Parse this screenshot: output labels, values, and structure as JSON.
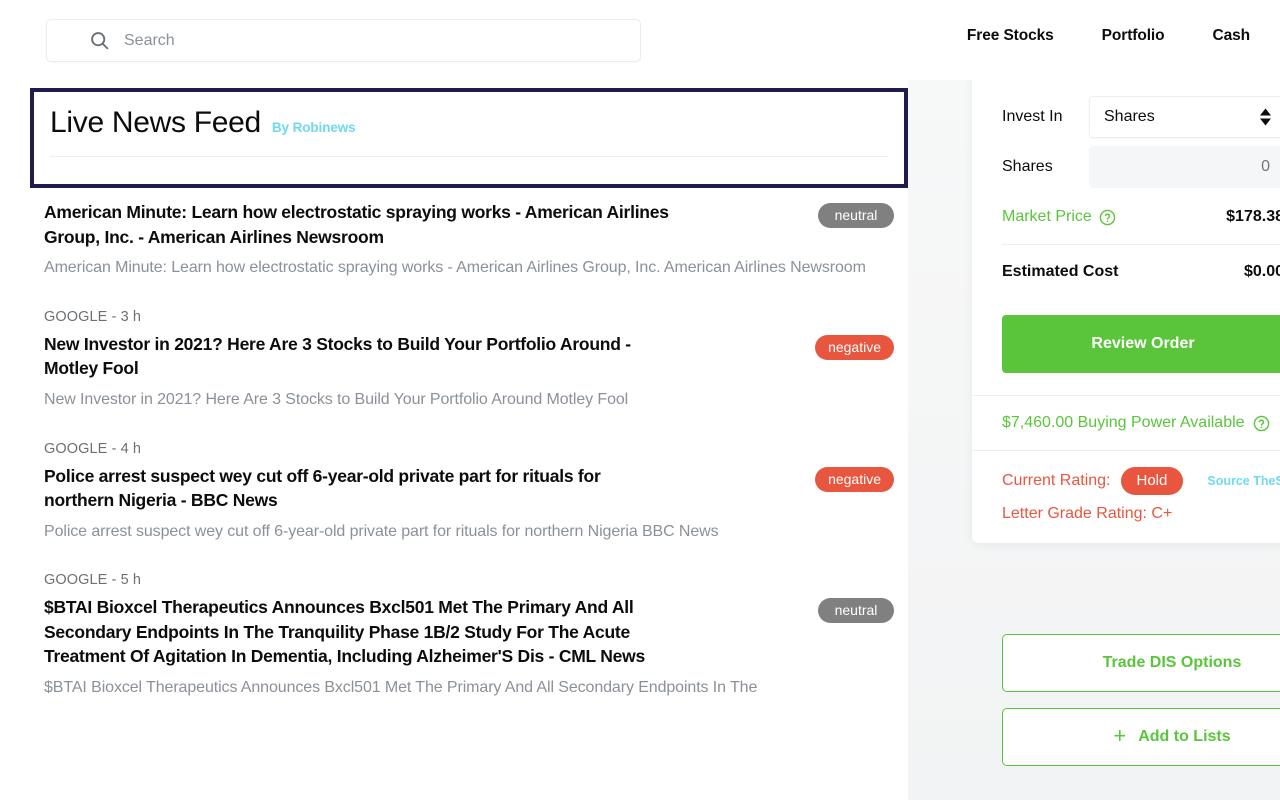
{
  "search": {
    "placeholder": "Search",
    "value": "",
    "icon": "search-icon"
  },
  "nav": {
    "items": [
      {
        "label": "Free Stocks"
      },
      {
        "label": "Portfolio"
      },
      {
        "label": "Cash"
      }
    ]
  },
  "feed": {
    "title": "Live News Feed",
    "byline": "By Robinews",
    "byline_color": "#6fd9f2",
    "highlight_border_color": "#1f1b4d",
    "items": [
      {
        "source_time": "",
        "title": "American Minute: Learn how electrostatic spraying works - American Airlines Group, Inc. - American Airlines Newsroom",
        "description": "American Minute: Learn how electrostatic spraying works - American Airlines Group, Inc.  American Airlines Newsroom",
        "sentiment": "neutral",
        "sentiment_color": "#808080"
      },
      {
        "source_time": "GOOGLE - 3 h",
        "title": "New Investor in 2021? Here Are 3 Stocks to Build Your Portfolio Around - Motley Fool",
        "description": "New Investor in 2021? Here Are 3 Stocks to Build Your Portfolio Around  Motley Fool",
        "sentiment": "negative",
        "sentiment_color": "#e8563f"
      },
      {
        "source_time": "GOOGLE - 4 h",
        "title": "Police arrest suspect wey cut off 6-year-old private part for rituals for northern Nigeria - BBC News",
        "description": "Police arrest suspect wey cut off 6-year-old private part for rituals for northern Nigeria  BBC News",
        "sentiment": "negative",
        "sentiment_color": "#e8563f"
      },
      {
        "source_time": "GOOGLE - 5 h",
        "title": "$BTAI Bioxcel Therapeutics Announces Bxcl501 Met The Primary And All Secondary Endpoints In The Tranquility Phase 1B/2 Study For The Acute Treatment Of Agitation In Dementia, Including Alzheimer'S Dis - CML News",
        "description": "$BTAI Bioxcel Therapeutics Announces Bxcl501 Met The Primary And All Secondary Endpoints In The",
        "sentiment": "neutral",
        "sentiment_color": "#808080"
      }
    ]
  },
  "order_panel": {
    "invest_in_label": "Invest In",
    "invest_in_value": "Shares",
    "shares_label": "Shares",
    "shares_value": "0",
    "market_price_label": "Market Price",
    "market_price_value": "$178.38",
    "estimated_cost_label": "Estimated Cost",
    "estimated_cost_value": "$0.00",
    "review_order_label": "Review Order",
    "buying_power": "$7,460.00 Buying Power Available",
    "current_rating_label": "Current Rating:",
    "current_rating_value": "Hold",
    "source_link": "Source TheStr",
    "letter_grade": "Letter Grade Rating: C+",
    "accent_green": "#5ac53b",
    "accent_red": "#e8563f"
  },
  "actions": {
    "trade_options_label": "Trade DIS Options",
    "add_to_lists_label": "Add to Lists",
    "plus_icon": "plus-icon"
  }
}
